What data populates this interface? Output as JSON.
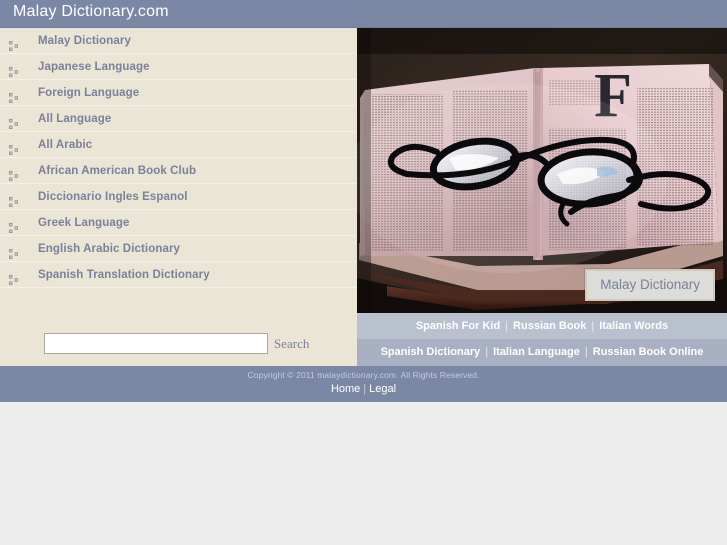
{
  "header": {
    "title": "Malay Dictionary.com",
    "bg_color": "#7b88a5"
  },
  "sidebar": {
    "bg_color": "#ebe5d5",
    "link_color": "#7a819b",
    "bullet_icon": "bullet-squares-icon",
    "items": [
      {
        "label": "Malay Dictionary"
      },
      {
        "label": "Japanese Language"
      },
      {
        "label": "Foreign Language"
      },
      {
        "label": "All Language"
      },
      {
        "label": "All Arabic"
      },
      {
        "label": "African American Book Club"
      },
      {
        "label": "Diccionario Ingles Espanol"
      },
      {
        "label": "Greek Language"
      },
      {
        "label": "English Arabic Dictionary"
      },
      {
        "label": "Spanish Translation Dictionary"
      }
    ],
    "search": {
      "value": "",
      "placeholder": "",
      "button_label": "Search"
    }
  },
  "photo": {
    "alt": "open-dictionary-with-reading-glasses",
    "caption": "Malay Dictionary"
  },
  "link_rows": [
    {
      "bg_color": "#b9c0ce",
      "links": [
        "Spanish For Kid",
        "Russian Book",
        "Italian Words"
      ],
      "separator": "|"
    },
    {
      "bg_color": "#a8b0c2",
      "links": [
        "Spanish Dictionary",
        "Italian Language",
        "Russian Book Online"
      ],
      "separator": "|"
    }
  ],
  "footer": {
    "bg_color": "#7b88a5",
    "copyright": "Copyright © 2011 malaydictionary.com. All Rights Reserved.",
    "links": [
      "Home",
      "Legal"
    ],
    "separator": "|"
  }
}
